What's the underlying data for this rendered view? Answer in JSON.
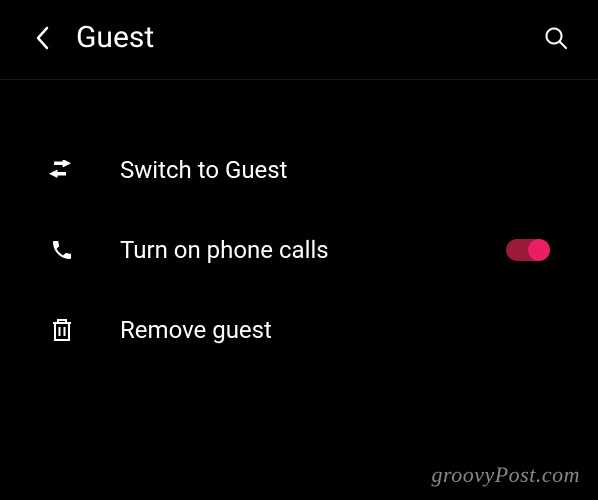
{
  "header": {
    "title": "Guest"
  },
  "items": {
    "switch": {
      "label": "Switch to Guest"
    },
    "phone": {
      "label": "Turn on phone calls",
      "toggle_on": true
    },
    "remove": {
      "label": "Remove guest"
    }
  },
  "watermark": "groovyPost.com",
  "colors": {
    "toggle_track": "#9b1a3a",
    "toggle_thumb": "#e91e63"
  }
}
